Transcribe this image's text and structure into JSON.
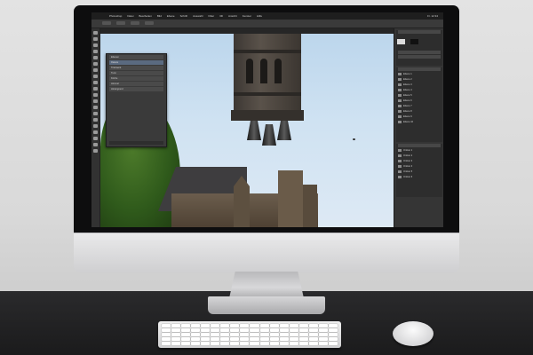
{
  "app": {
    "menu": [
      "Photoshop",
      "Datei",
      "Bearbeiten",
      "Bild",
      "Ebene",
      "Schrift",
      "Auswahl",
      "Filter",
      "3D",
      "Ansicht",
      "Fenster",
      "Hilfe"
    ],
    "status": "Fr. 12:34"
  },
  "layers_panel": {
    "rows": [
      "Ebenen",
      "Rakete",
      "Triebwerk",
      "Turm",
      "Kirche",
      "Himmel",
      "Hintergrund"
    ]
  },
  "right_panel": {
    "items": [
      "Ebene 1",
      "Ebene 2",
      "Ebene 3",
      "Ebene 4",
      "Ebene 5",
      "Ebene 6",
      "Ebene 7",
      "Ebene 8",
      "Ebene 9",
      "Ebene 10"
    ],
    "folders": [
      "Ordner 1",
      "Ordner 2",
      "Ordner 3",
      "Ordner 4",
      "Ordner 5",
      "Ordner 6"
    ]
  }
}
